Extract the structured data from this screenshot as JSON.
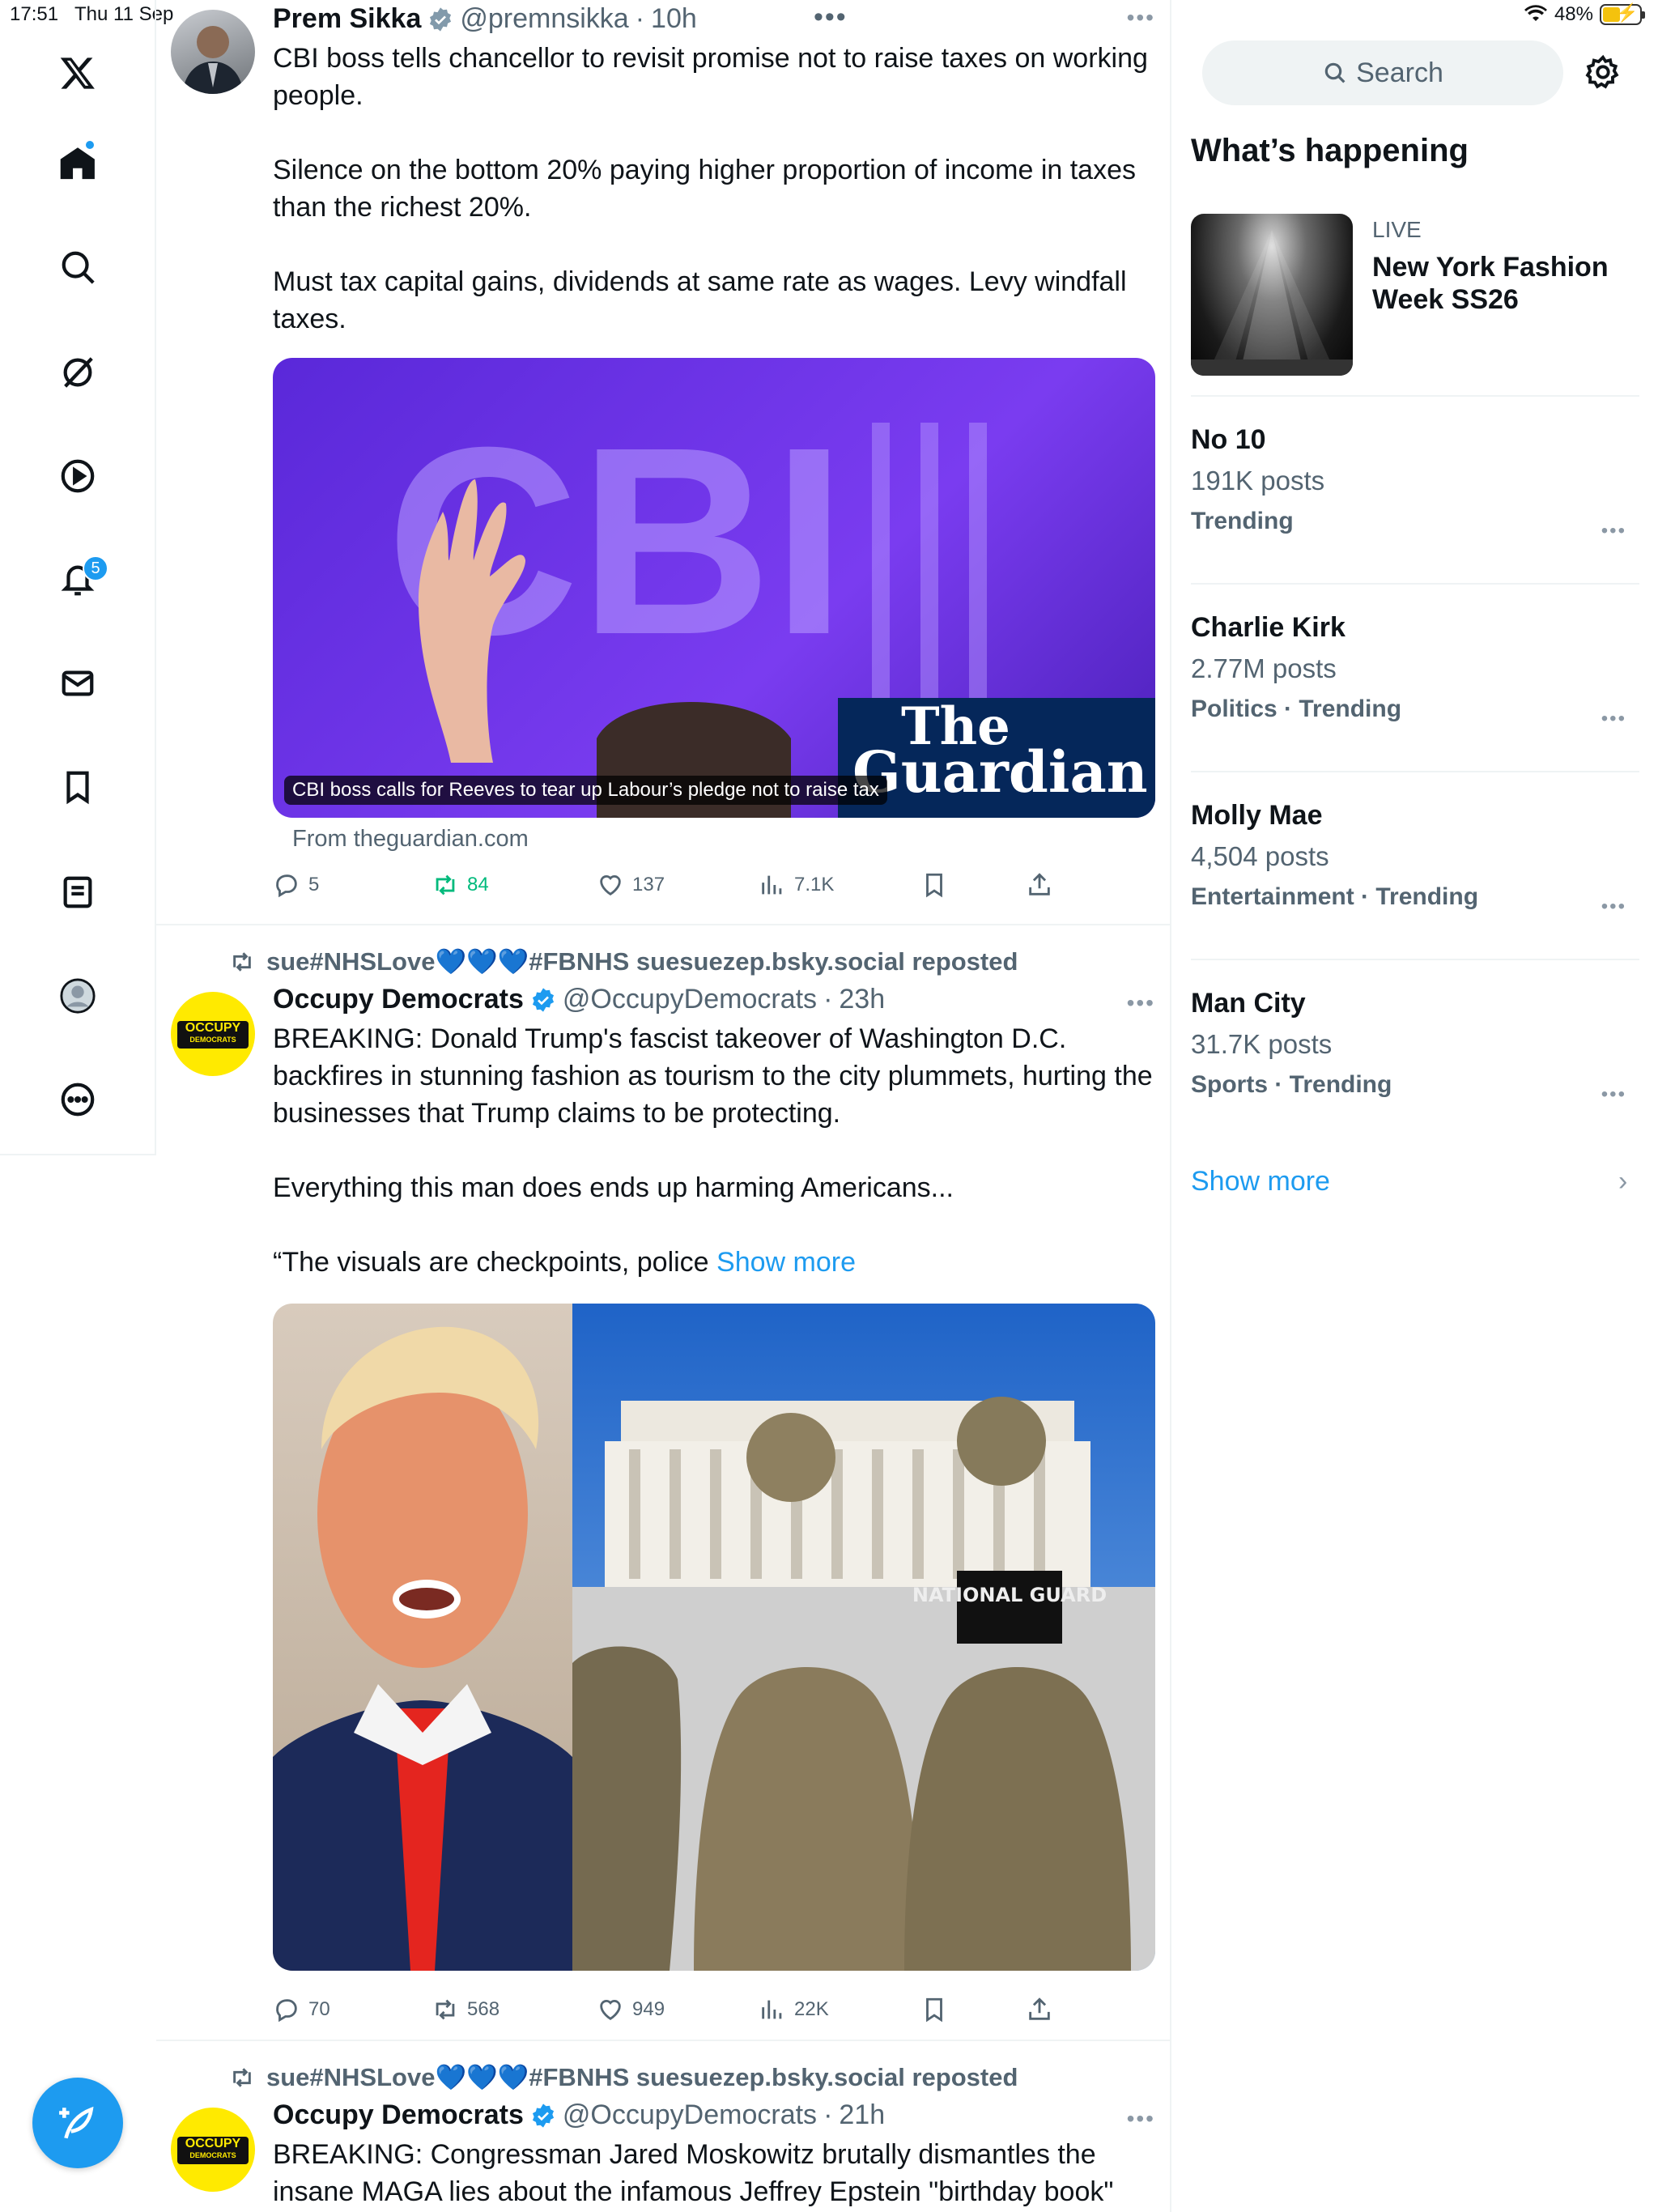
{
  "status_bar": {
    "time": "17:51",
    "date": "Thu 11 Sep",
    "battery": "48%"
  },
  "nav": {
    "notifications_badge": "5"
  },
  "tweets": [
    {
      "name": "Prem Sikka",
      "handle": "@premnsikka",
      "time": "10h",
      "text": "CBI boss tells chancellor to revisit promise not to raise taxes on working people.\n\nSilence on the bottom 20% paying higher proportion of income in taxes than the richest 20%.\n\nMust tax capital gains, dividends at same rate as wages. Levy windfall taxes.",
      "card": {
        "headline": "CBI boss calls for Reeves to tear up Labour’s pledge not to raise tax",
        "logo_line1": "The",
        "logo_line2": "Guardian",
        "image_text": "CBI",
        "source": "From theguardian.com"
      },
      "replies": "5",
      "reposts": "84",
      "likes": "137",
      "views": "7.1K"
    },
    {
      "reposted_by": "sue#NHSLove💙💙💙#FBNHS suesuezep.bsky.social reposted",
      "name": "Occupy Democrats",
      "handle": "@OccupyDemocrats",
      "time": "23h",
      "text_main": "BREAKING: Donald Trump's fascist takeover of Washington D.C. backfires in stunning fashion as tourism to the city plummets, hurting the businesses that Trump claims to be protecting.\n\nEverything this man does ends up harming Americans...\n\n“The visuals are checkpoints, police ",
      "show_more": "Show more",
      "image_text": "NATIONAL GUARD",
      "replies": "70",
      "reposts": "568",
      "likes": "949",
      "views": "22K"
    },
    {
      "reposted_by": "sue#NHSLove💙💙💙#FBNHS suesuezep.bsky.social reposted",
      "name": "Occupy Democrats",
      "handle": "@OccupyDemocrats",
      "time": "21h",
      "text": "BREAKING: Congressman Jared Moskowitz brutally dismantles the insane MAGA lies about the infamous Jeffrey Epstein \"birthday book\""
    }
  ],
  "avatar_logo": {
    "line1": "OCCUPY",
    "line2": "DEMOCRATS"
  },
  "right": {
    "search_placeholder": "Search",
    "heading": "What’s happening",
    "live": {
      "label": "LIVE",
      "title": "New York Fashion Week SS26"
    },
    "trends": [
      {
        "title": "No 10",
        "count": "191K posts",
        "category": "Trending"
      },
      {
        "title": "Charlie Kirk",
        "count": "2.77M posts",
        "category": "Politics · Trending"
      },
      {
        "title": "Molly Mae",
        "count": "4,504 posts",
        "category": "Entertainment · Trending"
      },
      {
        "title": "Man City",
        "count": "31.7K posts",
        "category": "Sports · Trending"
      }
    ],
    "show_more": "Show more"
  },
  "colors": {
    "accent": "#1d9bf0",
    "repost_green": "#00ba7c",
    "text": "#0f1419",
    "muted": "#536471"
  }
}
